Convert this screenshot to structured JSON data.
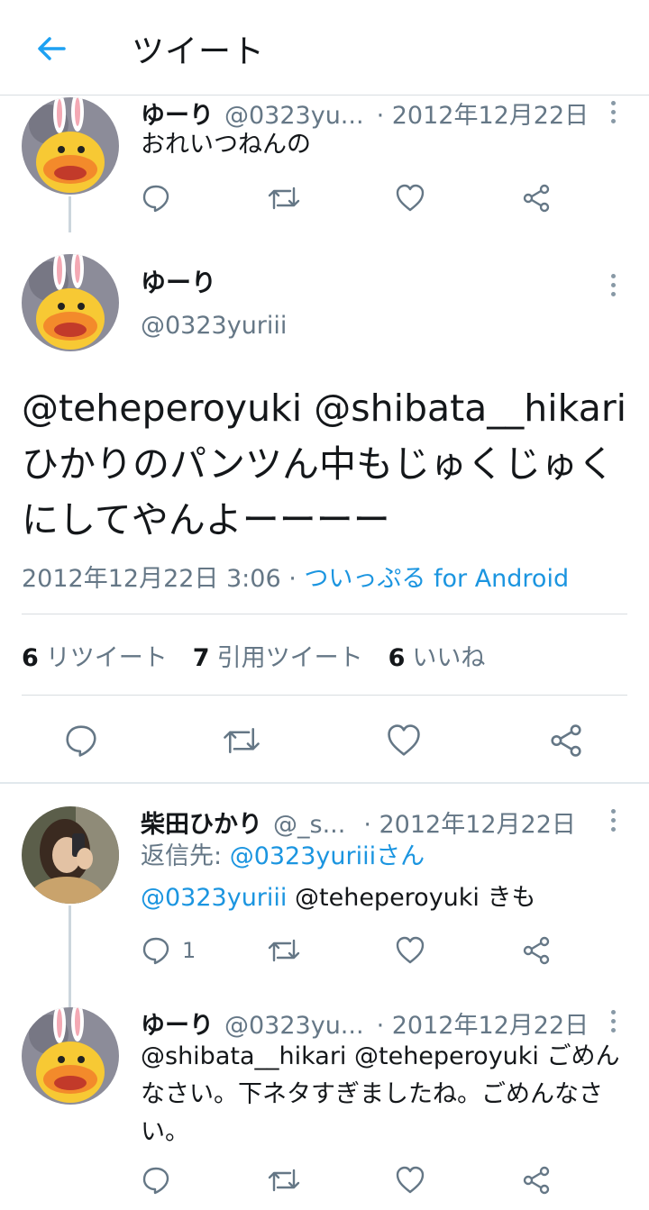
{
  "header": {
    "title": "ツイート"
  },
  "prev_tweet": {
    "name": "ゆーり",
    "handle": "@0323yu...",
    "date": "· 2012年12月22日",
    "text": "おれいつねんの"
  },
  "main_tweet": {
    "name": "ゆーり",
    "handle": "@0323yuriii",
    "text": "@teheperoyuki @shibata__hikari ひかりのパンツん中もじゅくじゅくにしてやんよーーーー",
    "timestamp": "2012年12月22日 3:06 ·",
    "source": "ついっぷる for Android",
    "stats": {
      "retweets_count": "6",
      "retweets_label": "リツイート",
      "quotes_count": "7",
      "quotes_label": "引用ツイート",
      "likes_count": "6",
      "likes_label": "いいね"
    }
  },
  "reply1": {
    "name": "柴田ひかり",
    "handle": "@_s...",
    "date": "· 2012年12月22日",
    "reply_prefix": "返信先: ",
    "reply_to": "@0323yuriiiさん",
    "mention": "@0323yuriii",
    "text_rest": " @teheperoyuki きも",
    "reply_count": "1"
  },
  "reply2": {
    "name": "ゆーり",
    "handle": "@0323yu...",
    "date": "· 2012年12月22日",
    "text": "@shibata__hikari @teheperoyuki ごめんなさい。下ネタすぎましたね。ごめんなさい。"
  },
  "colors": {
    "accent": "#1da1f2",
    "link": "#1b95e0",
    "muted": "#657786"
  }
}
